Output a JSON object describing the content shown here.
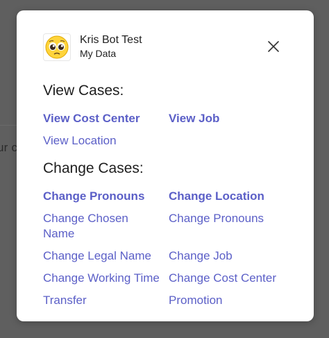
{
  "backdrop": {
    "text": "ur c"
  },
  "dialog": {
    "title": "Kris Bot Test",
    "subtitle": "My Data",
    "avatar_icon": "pleading-face-emoji",
    "close_icon": "close-icon"
  },
  "view_cases": {
    "heading": "View Cases:",
    "links": [
      "View Cost Center",
      "View Job",
      "View Location"
    ]
  },
  "change_cases": {
    "heading": "Change Cases:",
    "links": [
      "Change Pronouns",
      "Change Location",
      "Change Chosen Name",
      "Change Pronouns",
      "Change Legal Name",
      "Change Job",
      "Change Working Time",
      "Change Cost Center",
      "Transfer",
      "Promotion"
    ]
  },
  "colors": {
    "link": "#5b5fc7",
    "overlay": "#5f5f5f"
  }
}
